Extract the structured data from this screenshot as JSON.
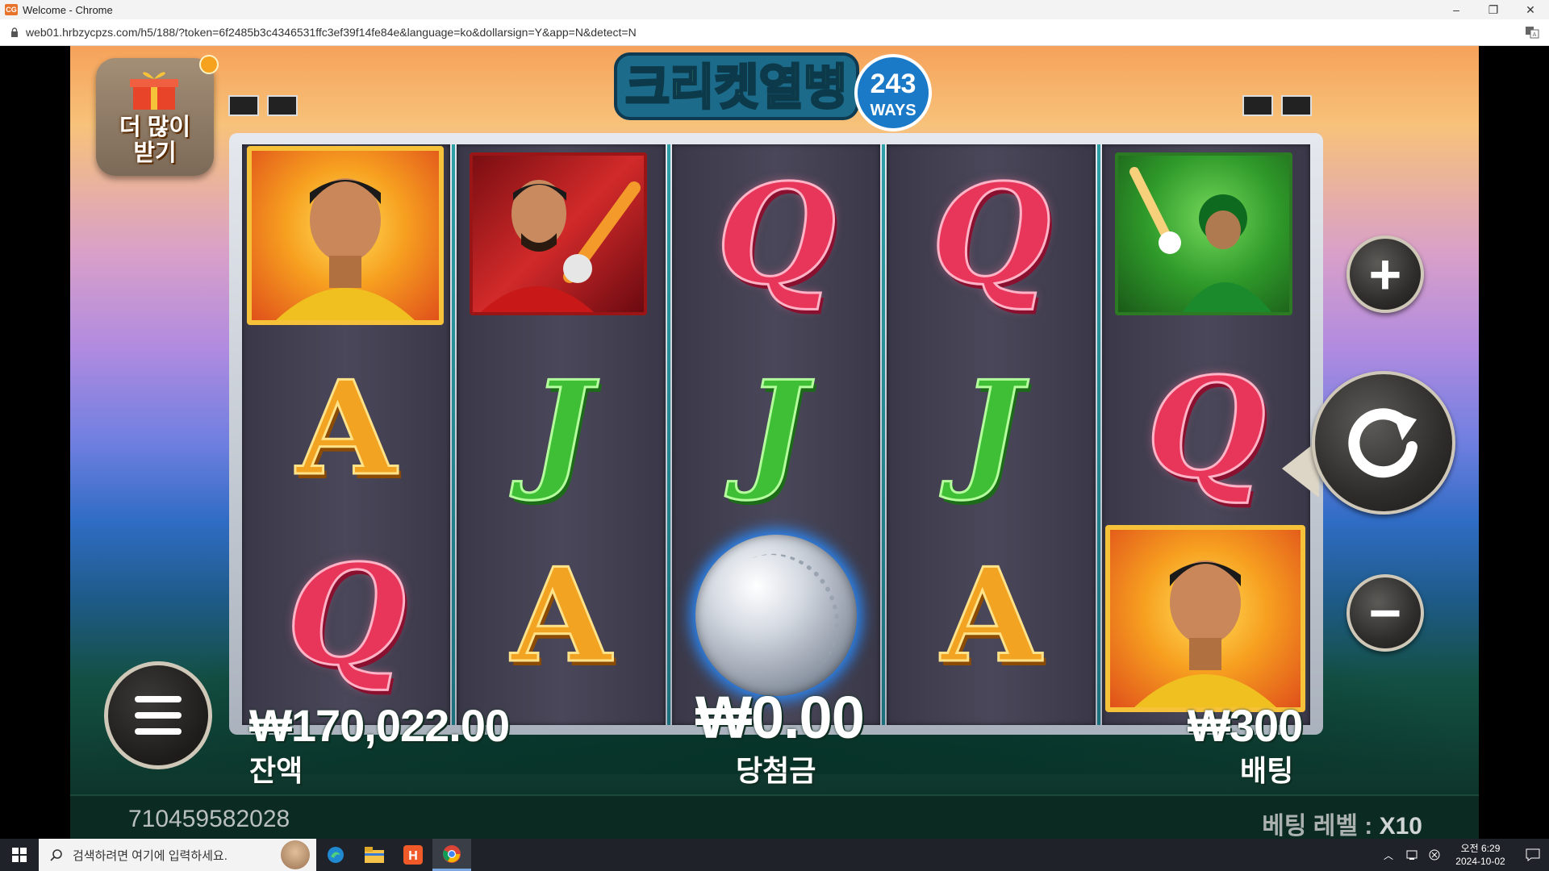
{
  "window": {
    "title": "Welcome - Chrome",
    "app_badge": "CG",
    "minimize": "–",
    "restore": "❐",
    "close": "✕"
  },
  "address_bar": {
    "url": "web01.hrbzycpzs.com/h5/188/?token=6f2485b3c4346531ffc3ef39f14fe84e&language=ko&dollarsign=Y&app=N&detect=N"
  },
  "game": {
    "logo_text": "크리켓열병",
    "logo_badge": "243",
    "logo_badge_sub": "WAYS",
    "promo_button": "더 많이\n받기",
    "reels": [
      [
        "card-gold-captain",
        "A",
        "Q"
      ],
      [
        "card-red-batsman",
        "J",
        "A"
      ],
      [
        "Q",
        "J",
        "cricket-ball"
      ],
      [
        "Q",
        "J",
        "A"
      ],
      [
        "card-green-batsman",
        "Q",
        "card-gold-captain"
      ]
    ],
    "balance_value": "₩170,022.00",
    "balance_label": "잔액",
    "win_value": "₩0.00",
    "win_label": "당첨금",
    "bet_value": "₩300",
    "bet_label": "배팅",
    "round_id": "710459582028",
    "bet_level_label": "베팅 레벨 : ",
    "bet_level_value": "X10",
    "plus_symbol": "+",
    "minus_symbol": "−"
  },
  "taskbar": {
    "search_placeholder": "검색하려면 여기에 입력하세요.",
    "time": "오전 6:29",
    "date": "2024-10-02"
  },
  "colors": {
    "accent_gold": "#f6c23a",
    "q_pink": "#e8355a",
    "j_green": "#3fbf35",
    "a_orange": "#f3a322"
  }
}
